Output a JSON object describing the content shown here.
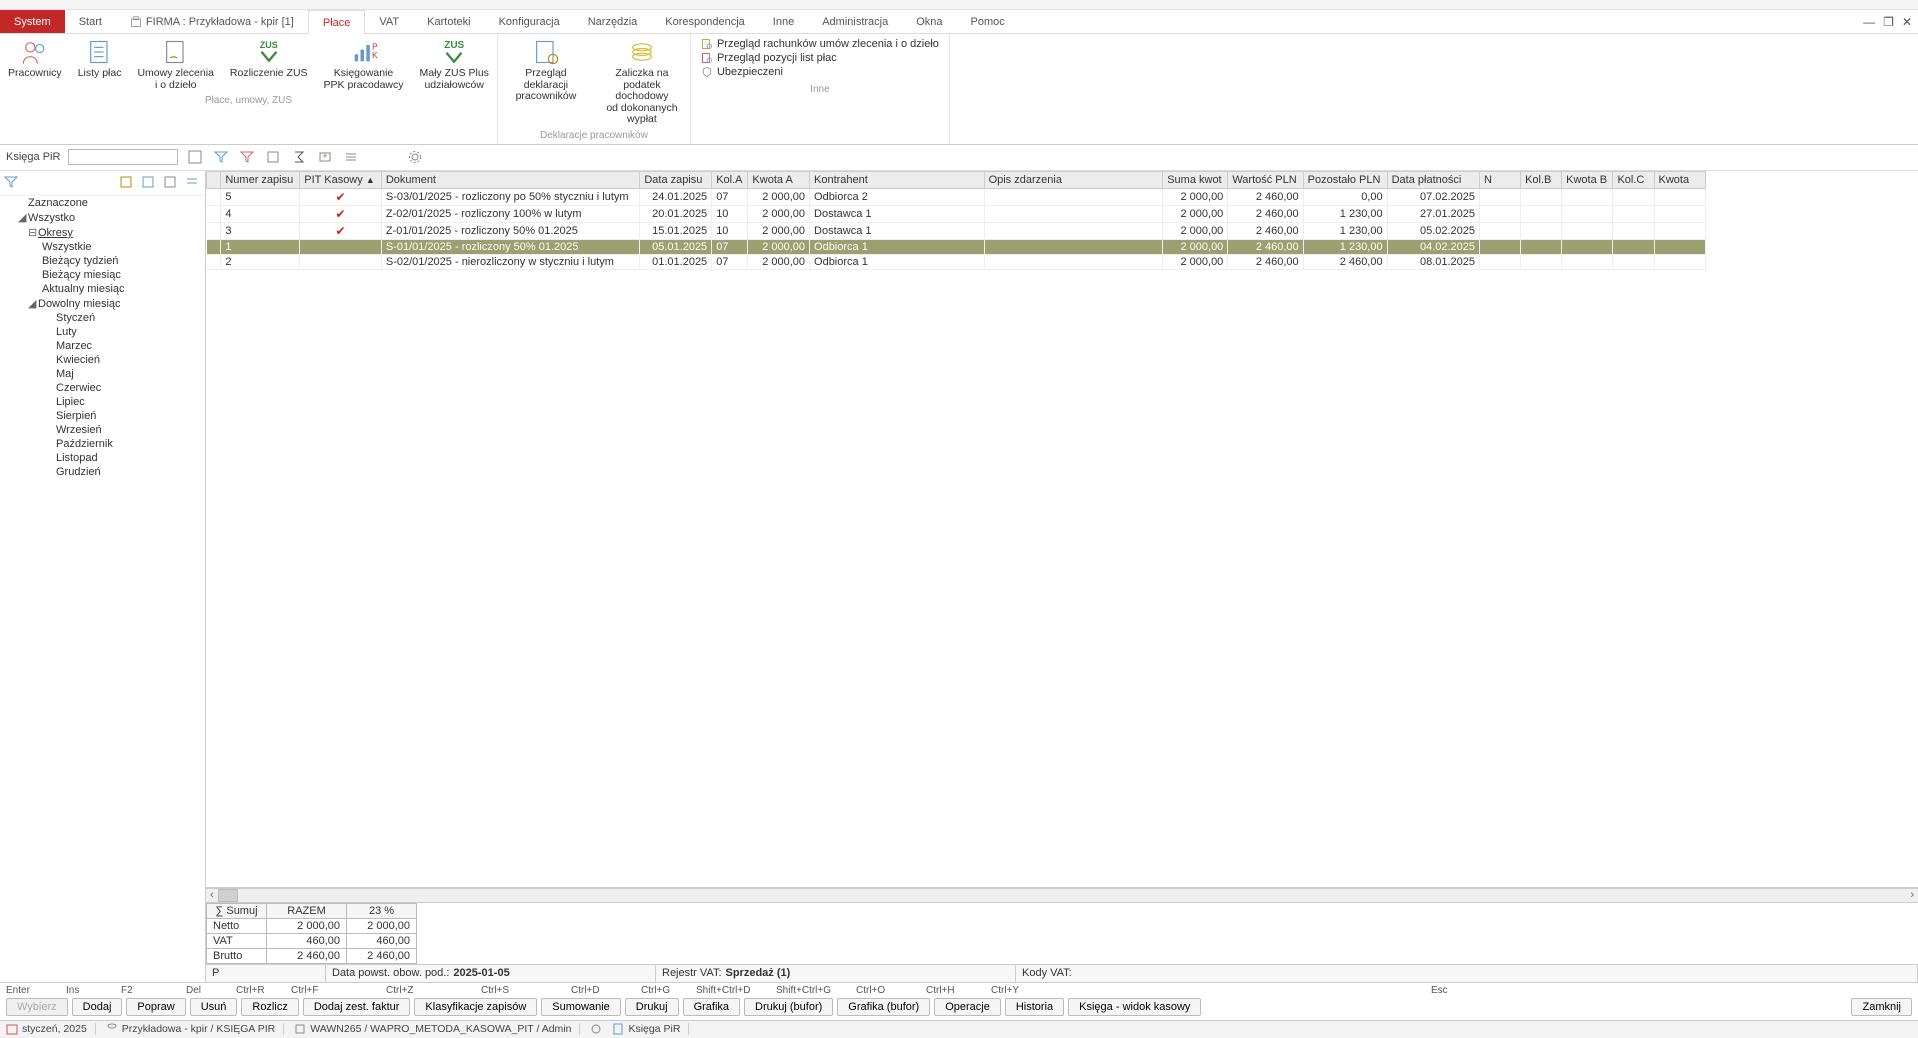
{
  "menu": {
    "system": "System",
    "tabs": [
      "Start",
      "Płace",
      "VAT",
      "Kartoteki",
      "Konfiguracja",
      "Narzędzia",
      "Korespondencja",
      "Inne",
      "Administracja",
      "Okna",
      "Pomoc"
    ],
    "firma": "FIRMA : Przykładowa - kpir [1]",
    "active": "Płace"
  },
  "ribbon": {
    "g1": {
      "label": "Płace, umowy, ZUS",
      "btns": [
        "Pracownicy",
        "Listy płac",
        "Umowy zlecenia\ni o dzieło",
        "Rozliczenie ZUS",
        "Księgowanie\nPPK pracodawcy",
        "Mały ZUS Plus\nudziałowców"
      ]
    },
    "g2": {
      "label": "Deklaracje pracowników",
      "btns": [
        "Przegląd deklaracji\npracowników",
        "Zaliczka na podatek dochodowy\nod dokonanych wypłat"
      ]
    },
    "g3": {
      "label": "Inne",
      "links": [
        "Przegląd rachunków umów zlecenia i o dzieło",
        "Przegląd pozycji list płac",
        "Ubezpieczeni"
      ]
    }
  },
  "toolbar": {
    "title": "Księga PiR"
  },
  "tree": {
    "items": [
      "Zaznaczone",
      "Wszystko",
      "Okresy",
      "Wszystkie",
      "Bieżący tydzień",
      "Bieżący miesiąc",
      "Aktualny miesiąc",
      "Dowolny miesiąc",
      "Styczeń",
      "Luty",
      "Marzec",
      "Kwiecień",
      "Maj",
      "Czerwiec",
      "Lipiec",
      "Sierpień",
      "Wrzesień",
      "Październik",
      "Listopad",
      "Grudzień"
    ]
  },
  "grid": {
    "headers": [
      "",
      "Numer zapisu",
      "PIT Kasowy",
      "Dokument",
      "Data zapisu",
      "Kol.A",
      "Kwota A",
      "Kontrahent",
      "Opis zdarzenia",
      "Suma kwot",
      "Wartość PLN",
      "Pozostało PLN",
      "Data płatności",
      "N",
      "Kol.B",
      "Kwota B",
      "Kol.C",
      "Kwota"
    ],
    "rows": [
      {
        "n": "5",
        "pit": true,
        "dok": "S-03/01/2025 - rozliczony po 50% styczniu i lutym",
        "data": "24.01.2025",
        "kola": "07",
        "kwa": "2 000,00",
        "kontr": "Odbiorca 2",
        "suma": "2 000,00",
        "wart": "2 460,00",
        "poz": "0,00",
        "plat": "07.02.2025"
      },
      {
        "n": "4",
        "pit": true,
        "dok": "Z-02/01/2025 - rozliczony 100% w lutym",
        "data": "20.01.2025",
        "kola": "10",
        "kwa": "2 000,00",
        "kontr": "Dostawca 1",
        "suma": "2 000,00",
        "wart": "2 460,00",
        "poz": "1 230,00",
        "plat": "27.01.2025"
      },
      {
        "n": "3",
        "pit": true,
        "dok": "Z-01/01/2025 - rozliczony 50% 01.2025",
        "data": "15.01.2025",
        "kola": "10",
        "kwa": "2 000,00",
        "kontr": "Dostawca 1",
        "suma": "2 000,00",
        "wart": "2 460,00",
        "poz": "1 230,00",
        "plat": "05.02.2025"
      },
      {
        "n": "1",
        "pit": false,
        "dok": "S-01/01/2025 - rozliczony 50% 01.2025",
        "data": "05.01.2025",
        "kola": "07",
        "kwa": "2 000,00",
        "kontr": "Odbiorca 1",
        "suma": "2 000,00",
        "wart": "2 460,00",
        "poz": "1 230,00",
        "plat": "04.02.2025",
        "sel": true
      },
      {
        "n": "2",
        "pit": false,
        "dok": "S-02/01/2025 - nierozliczony w styczniu i lutym",
        "data": "01.01.2025",
        "kola": "07",
        "kwa": "2 000,00",
        "kontr": "Odbiorca 1",
        "suma": "2 000,00",
        "wart": "2 460,00",
        "poz": "2 460,00",
        "plat": "08.01.2025"
      }
    ]
  },
  "summary": {
    "cols": [
      "∑  Sumuj",
      "RAZEM",
      "23 %"
    ],
    "rows": [
      {
        "l": "Netto",
        "a": "2 000,00",
        "b": "2 000,00"
      },
      {
        "l": "VAT",
        "a": "460,00",
        "b": "460,00"
      },
      {
        "l": "Brutto",
        "a": "2 460,00",
        "b": "2 460,00"
      }
    ]
  },
  "info": {
    "p": "P",
    "data_label": "Data powst. obow. pod.:",
    "data_val": "2025-01-05",
    "rejestr_label": "Rejestr VAT:",
    "rejestr_val": "Sprzedaż (1)",
    "kody": "Kody VAT:"
  },
  "shortcuts": [
    "Enter",
    "Ins",
    "F2",
    "Del",
    "Ctrl+R",
    "Ctrl+F",
    "Ctrl+Z",
    "Ctrl+S",
    "Ctrl+D",
    "Ctrl+G",
    "Shift+Ctrl+D",
    "Shift+Ctrl+G",
    "Ctrl+O",
    "Ctrl+H",
    "Ctrl+Y",
    "Esc"
  ],
  "buttons": [
    "Wybierz",
    "Dodaj",
    "Popraw",
    "Usuń",
    "Rozlicz",
    "Dodaj zest. faktur",
    "Klasyfikacje zapisów",
    "Sumowanie",
    "Drukuj",
    "Grafika",
    "Drukuj (bufor)",
    "Grafika (bufor)",
    "Operacje",
    "Historia",
    "Księga - widok kasowy",
    "Zamknij"
  ],
  "status": {
    "period": "styczeń, 2025",
    "firma": "Przykładowa - kpir / KSIĘGA PIR",
    "db": "WAWN265 / WAPRO_METODA_KASOWA_PIT / Admin",
    "doc": "Księga PiR"
  },
  "zus_text": "ZUS"
}
